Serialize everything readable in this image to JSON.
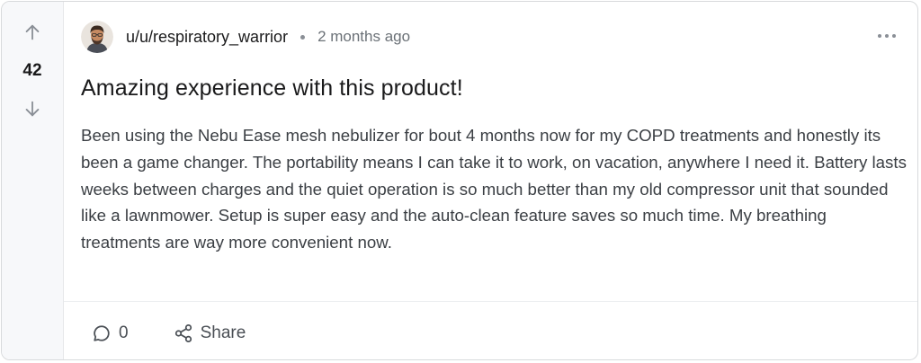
{
  "vote": {
    "score": "42"
  },
  "post": {
    "username": "u/u/respiratory_warrior",
    "timestamp": "2 months ago",
    "title": "Amazing experience with this product!",
    "body": "Been using the Nebu Ease mesh nebulizer for bout 4 months now for my COPD treatments and honestly its been a game changer. The portability means I can take it to work, on vacation, anywhere I need it. Battery lasts weeks between charges and the quiet operation is so much better than my old compressor unit that sounded like a lawnmower. Setup is super easy and the auto-clean feature saves so much time. My breathing treatments are way more convenient now."
  },
  "actions": {
    "comment_count": "0",
    "share_label": "Share"
  },
  "icons": {
    "upvote": "arrow-up-icon",
    "downvote": "arrow-down-icon",
    "more": "more-horizontal-icon",
    "comment": "comment-bubble-icon",
    "share": "share-nodes-icon"
  },
  "colors": {
    "vote_column_bg": "#f7f8fa",
    "text_primary": "#1a1a1b",
    "text_secondary": "#6b7177",
    "border": "#d8dadc"
  }
}
